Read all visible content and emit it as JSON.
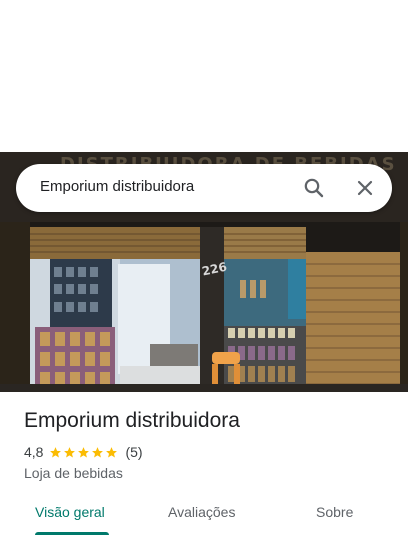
{
  "search": {
    "query": "Emporium distribuidora"
  },
  "hero": {
    "sign_text": "DISTRIBUIDORA DE BEBIDAS",
    "number": "226"
  },
  "place": {
    "name": "Emporium distribuidora",
    "rating": "4,8",
    "review_count": "(5)",
    "stars": 5,
    "category": "Loja de bebidas"
  },
  "tabs": [
    {
      "label": "Visão geral",
      "active": true
    },
    {
      "label": "Avaliações",
      "active": false
    },
    {
      "label": "Sobre",
      "active": false
    }
  ],
  "colors": {
    "accent": "#00796b",
    "star": "#fbbc04"
  },
  "icons": {
    "search": "search-icon",
    "close": "close-icon"
  }
}
